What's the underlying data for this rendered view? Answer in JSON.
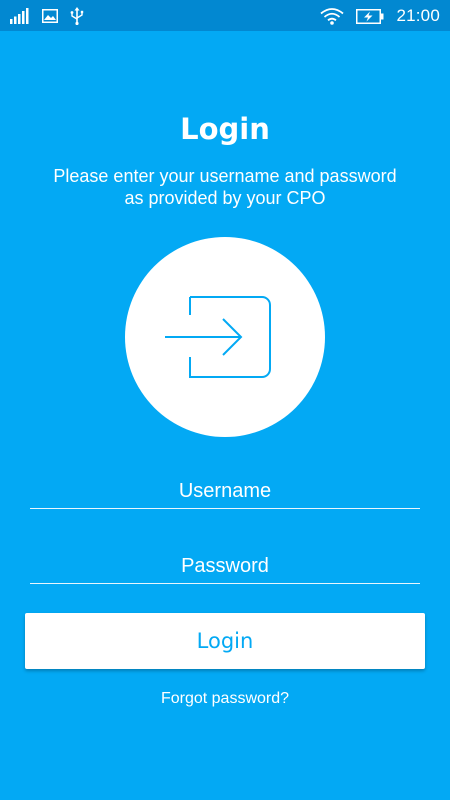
{
  "status_bar": {
    "time": "21:00",
    "icons": [
      "signal-bars-icon",
      "image-notification-icon",
      "usb-icon",
      "wifi-icon",
      "battery-charging-icon"
    ]
  },
  "login": {
    "title": "Login",
    "subtitle_line1": "Please enter your username and password",
    "subtitle_line2": "as provided by your CPO",
    "illustration_icon": "sign-in-arrow-icon",
    "username_placeholder": "Username",
    "password_placeholder": "Password",
    "button_label": "Login",
    "forgot_label": "Forgot password?"
  },
  "colors": {
    "background": "#03a9f4",
    "status_bar": "#0288d1",
    "accent": "#03a9f4",
    "surface": "#ffffff"
  }
}
